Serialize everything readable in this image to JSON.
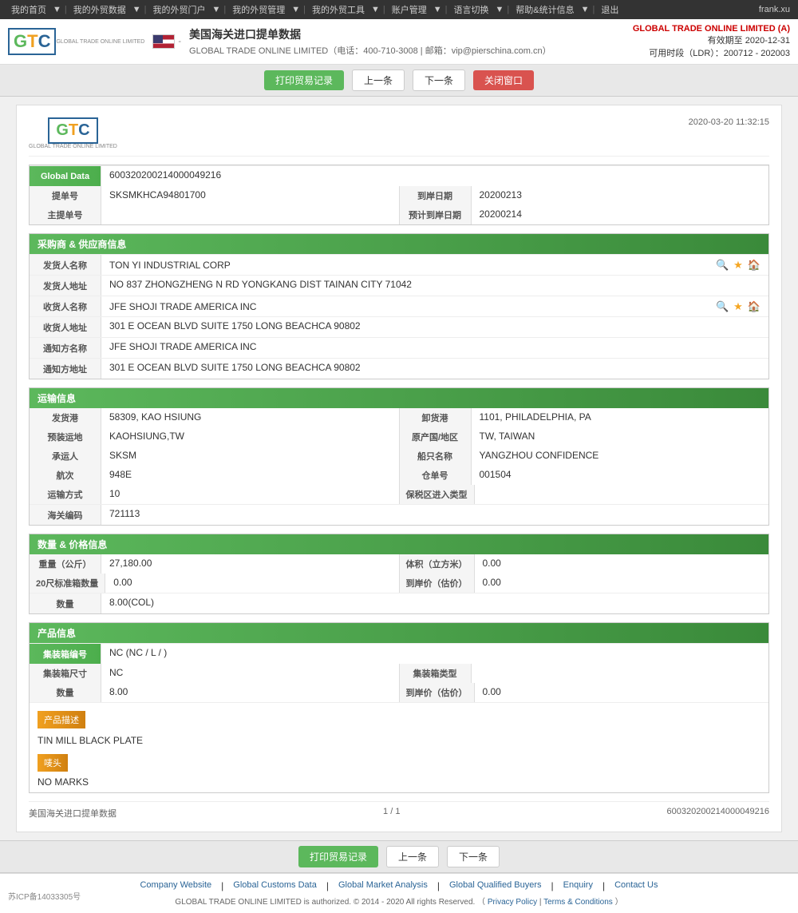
{
  "topnav": {
    "items": [
      "我的首页",
      "我的外贸数据",
      "我的外贸门户",
      "我的外贸管理",
      "我的外贸工具",
      "账户管理",
      "语言切换",
      "帮助&统计信息",
      "退出"
    ],
    "user": "frank.xu"
  },
  "header": {
    "logo_text": "GTC",
    "logo_sub": "GLOBAL TRADE ONLINE LIMITED",
    "flag_label": "美国",
    "title": "美国海关进口提单数据",
    "company_line": "GLOBAL TRADE ONLINE LIMITED（电话：400-710-3008 | 邮箱：vip@pierschina.com.cn）",
    "right_company": "GLOBAL TRADE ONLINE LIMITED (A)",
    "valid_until": "有效期至 2020-12-31",
    "ldr": "可用时段（LDR）：200712 - 202003"
  },
  "toolbar": {
    "print_btn": "打印贸易记录",
    "prev_btn": "上一条",
    "next_btn": "下一条",
    "close_btn": "关闭窗口"
  },
  "doc": {
    "logo_text": "GTC",
    "logo_sub": "GLOBAL TRADE ONLINE LIMITED",
    "datetime": "2020-03-20 11:32:15",
    "global_data_label": "Global Data",
    "global_data_value": "600320200214000049216",
    "bill_no_label": "提单号",
    "bill_no_value": "SKSMKHCA94801700",
    "arrival_date_label": "到岸日期",
    "arrival_date_value": "20200213",
    "main_bill_label": "主提单号",
    "main_bill_value": "",
    "est_arrival_label": "预计到岸日期",
    "est_arrival_value": "20200214"
  },
  "buyer_section": {
    "title": "采购商 & 供应商信息",
    "shipper_name_label": "发货人名称",
    "shipper_name_value": "TON YI INDUSTRIAL CORP",
    "shipper_addr_label": "发货人地址",
    "shipper_addr_value": "NO 837 ZHONGZHENG N RD YONGKANG DIST TAINAN CITY 71042",
    "consignee_name_label": "收货人名称",
    "consignee_name_value": "JFE SHOJI TRADE AMERICA INC",
    "consignee_addr_label": "收货人地址",
    "consignee_addr_value": "301 E OCEAN BLVD SUITE 1750 LONG BEACHCA 90802",
    "notify_name_label": "通知方名称",
    "notify_name_value": "JFE SHOJI TRADE AMERICA INC",
    "notify_addr_label": "通知方地址",
    "notify_addr_value": "301 E OCEAN BLVD SUITE 1750 LONG BEACHCA 90802"
  },
  "transport_section": {
    "title": "运输信息",
    "origin_port_label": "发货港",
    "origin_port_value": "58309, KAO HSIUNG",
    "dest_port_label": "卸货港",
    "dest_port_value": "1101, PHILADELPHIA, PA",
    "pre_load_label": "预装运地",
    "pre_load_value": "KAOHSIUNG,TW",
    "origin_country_label": "原产国/地区",
    "origin_country_value": "TW, TAIWAN",
    "carrier_label": "承运人",
    "carrier_value": "SKSM",
    "vessel_label": "船只名称",
    "vessel_value": "YANGZHOU CONFIDENCE",
    "voyage_label": "航次",
    "voyage_value": "948E",
    "warehouse_label": "仓单号",
    "warehouse_value": "001504",
    "transport_mode_label": "运输方式",
    "transport_mode_value": "10",
    "bonded_label": "保税区进入类型",
    "bonded_value": "",
    "customs_code_label": "海关编码",
    "customs_code_value": "721113"
  },
  "quantity_section": {
    "title": "数量 & 价格信息",
    "weight_label": "重量（公斤）",
    "weight_value": "27,180.00",
    "volume_label": "体积（立方米）",
    "volume_value": "0.00",
    "container20_label": "20尺标准箱数量",
    "container20_value": "0.00",
    "arrival_price_label": "到岸价（估价）",
    "arrival_price_value": "0.00",
    "quantity_label": "数量",
    "quantity_value": "8.00(COL)"
  },
  "product_section": {
    "title": "产品信息",
    "container_no_label": "集装箱编号",
    "container_no_value": "NC (NC / L / )",
    "container_size_label": "集装箱尺寸",
    "container_size_value": "NC",
    "container_type_label": "集装箱类型",
    "container_type_value": "",
    "quantity_label": "数量",
    "quantity_value": "8.00",
    "arrival_price_label": "到岸价（估价）",
    "arrival_price_value": "0.00",
    "product_desc_title": "产品描述",
    "product_desc_value": "TIN MILL BLACK PLATE",
    "marks_title": "唛头",
    "marks_value": "NO MARKS"
  },
  "pagination": {
    "source": "美国海关进口提单数据",
    "page": "1 / 1",
    "doc_id": "600320200214000049216"
  },
  "footer": {
    "links": [
      "Company Website",
      "Global Customs Data",
      "Global Market Analysis",
      "Global Qualified Buyers",
      "Enquiry",
      "Contact Us"
    ],
    "copyright": "GLOBAL TRADE ONLINE LIMITED is authorized. © 2014 - 2020 All rights Reserved.  （",
    "privacy": "Privacy Policy",
    "separator1": " | ",
    "terms": "Terms & Conditions",
    "copyright_end": "）",
    "beian": "苏ICP备14033305号"
  }
}
